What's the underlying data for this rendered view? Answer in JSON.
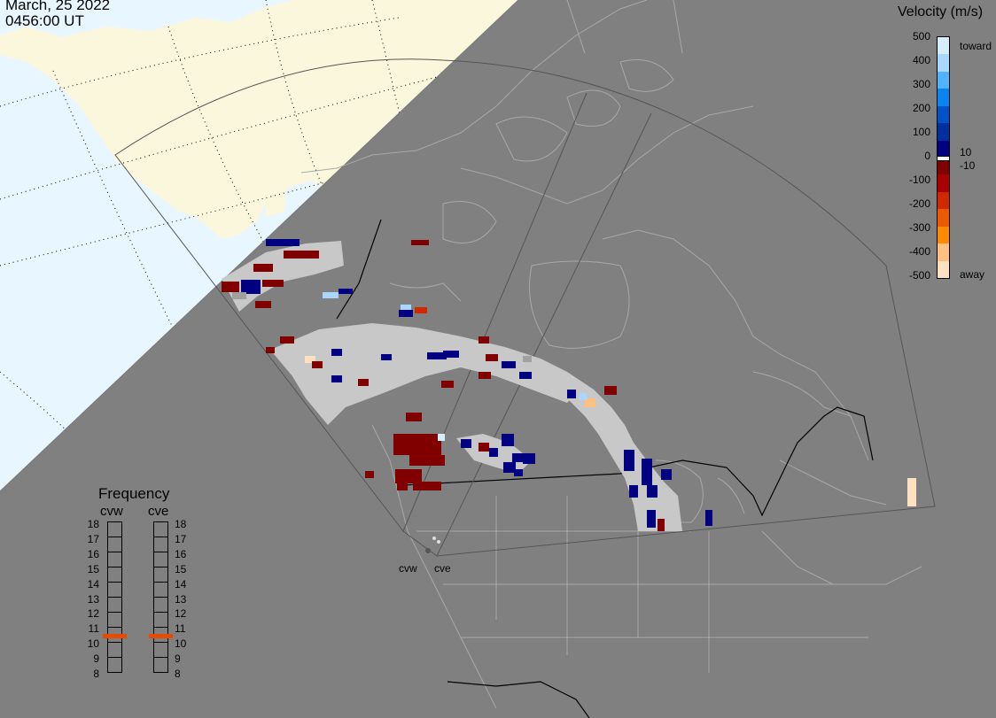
{
  "header": {
    "date": "March, 25 2022",
    "time": "0456:00 UT"
  },
  "velocity_scale": {
    "title": "Velocity (m/s)",
    "ticks": [
      "500",
      "400",
      "300",
      "200",
      "100",
      "0",
      "-100",
      "-200",
      "-300",
      "-400",
      "-500"
    ],
    "small_pos_label": "10",
    "small_neg_label": "-10",
    "toward_label": "toward",
    "away_label": "away",
    "colors": [
      "#d6ecff",
      "#a8d8ff",
      "#4fb3ff",
      "#0a84f0",
      "#0052c8",
      "#002fa0",
      "#000080",
      "#800000",
      "#a80000",
      "#d02800",
      "#ec5a00",
      "#ff8a00",
      "#ffc080",
      "#ffe0c0"
    ]
  },
  "frequency_panel": {
    "title": "Frequency",
    "radar1": "cvw",
    "radar2": "cve",
    "ticks": [
      "18",
      "17",
      "16",
      "15",
      "14",
      "13",
      "12",
      "11",
      "10",
      "9",
      "8"
    ],
    "radar1_mhz": 10.5,
    "radar2_mhz": 10.5,
    "marker_color": "#e84a00"
  },
  "sites": {
    "west": "cvw",
    "east": "cve"
  },
  "colors": {
    "ocean": "#e8f6ff",
    "land_unshaded": "#fbf7dc",
    "night": "#808080",
    "ground_scatter": "#c8c8c8",
    "borders": "#a8a8a8"
  }
}
